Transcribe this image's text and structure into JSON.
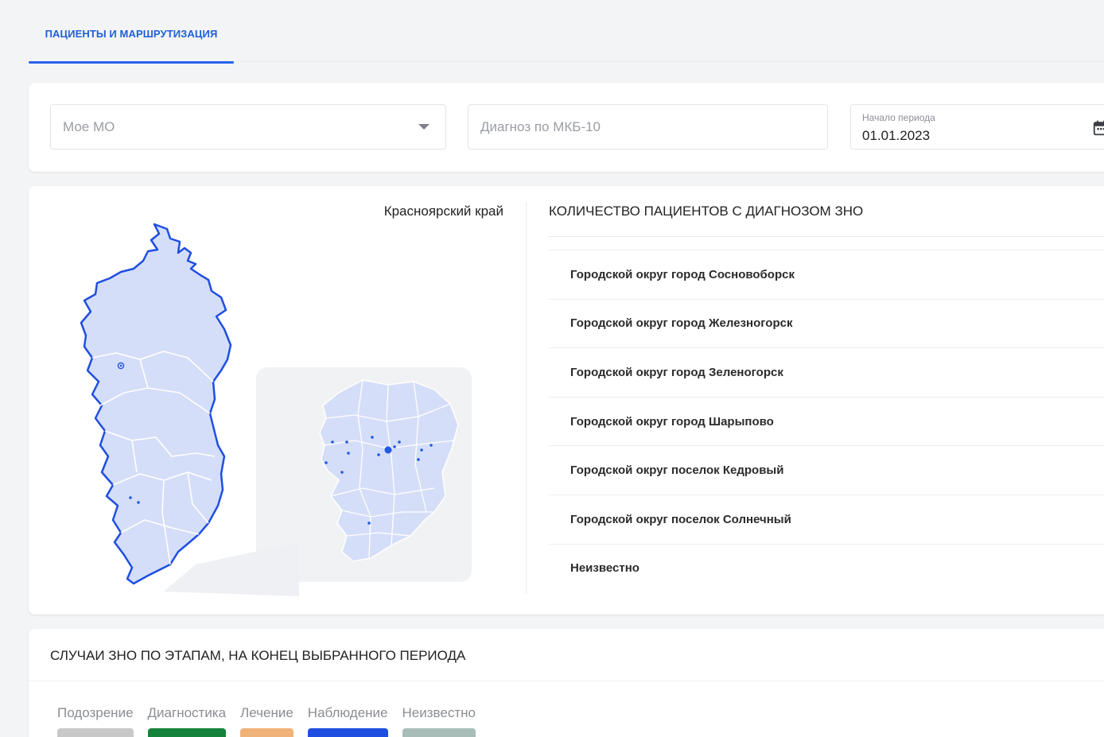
{
  "tabs": [
    {
      "label": "ПАЦИЕНТЫ И МАРШРУТИЗАЦИЯ",
      "active": true
    }
  ],
  "filters": {
    "mo_placeholder": "Мое МО",
    "diagnosis_placeholder": "Диагноз по МКБ-10",
    "period_start_label": "Начало периода",
    "period_start_value": "01.01.2023"
  },
  "map": {
    "region_title": "Красноярский край",
    "fill_color": "#d5def8",
    "border_color": "#1f4fe0",
    "marker_color": "#2357e6"
  },
  "patients_list": {
    "title": "КОЛИЧЕСТВО ПАЦИЕНТОВ С ДИАГНОЗОМ ЗНО",
    "items": [
      "Городской округ город Сосновоборск",
      "Городской округ город Железногорск",
      "Городской округ город Зеленогорск",
      "Городской округ город Шарыпово",
      "Городской округ поселок Кедровый",
      "Городской округ поселок Солнечный",
      "Неизвестно"
    ]
  },
  "stages": {
    "title": "СЛУЧАИ ЗНО ПО ЭТАПАМ, НА КОНЕЦ ВЫБРАННОГО ПЕРИОДА",
    "legend": [
      {
        "label": "Подозрение",
        "color": "#c8c8c8"
      },
      {
        "label": "Диагностика",
        "color": "#14833b"
      },
      {
        "label": "Лечение",
        "color": "#f1b27a"
      },
      {
        "label": "Наблюдение",
        "color": "#1f4fe0"
      },
      {
        "label": "Неизвестно",
        "color": "#a9bdb8"
      }
    ]
  }
}
